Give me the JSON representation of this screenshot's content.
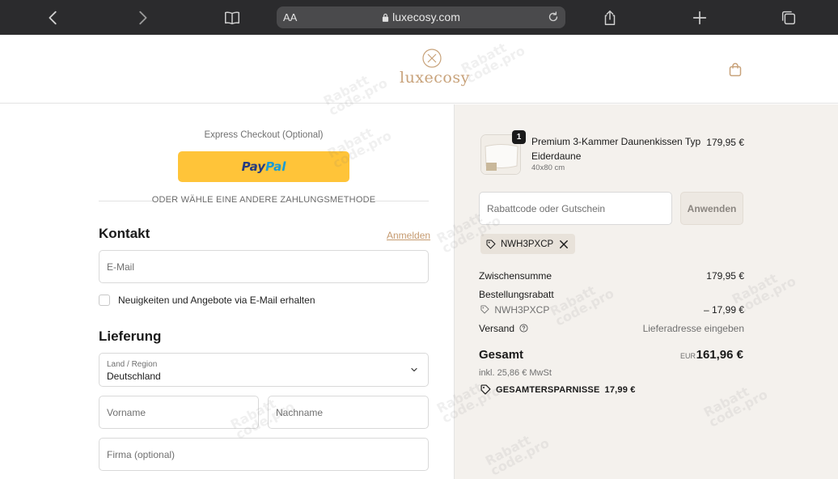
{
  "browser": {
    "text_size_label": "AA",
    "url": "luxecosy.com"
  },
  "header": {
    "brand": "luxecosy"
  },
  "checkout": {
    "express_label": "Express Checkout (Optional)",
    "paypal_label_1": "Pay",
    "paypal_label_2": "Pal",
    "divider_text": "ODER WÄHLE EINE ANDERE ZAHLUNGSMETHODE",
    "contact": {
      "title": "Kontakt",
      "login_link": "Anmelden",
      "email_placeholder": "E-Mail",
      "newsletter_label": "Neuigkeiten und Angebote via E-Mail erhalten"
    },
    "delivery": {
      "title": "Lieferung",
      "country_label": "Land / Region",
      "country_value": "Deutschland",
      "first_name_placeholder": "Vorname",
      "last_name_placeholder": "Nachname",
      "company_placeholder": "Firma (optional)"
    }
  },
  "summary": {
    "item": {
      "quantity": "1",
      "name": "Premium 3-Kammer Daunenkissen Typ Eiderdaune",
      "variant": "40x80 cm",
      "price": "179,95 €"
    },
    "discount_placeholder": "Rabattcode oder Gutschein",
    "apply_label": "Anwenden",
    "applied_code": "NWH3PXCP",
    "subtotal_label": "Zwischensumme",
    "subtotal_value": "179,95 €",
    "order_discount_label": "Bestellungsrabatt",
    "order_discount_code": "NWH3PXCP",
    "order_discount_value": "– 17,99 €",
    "shipping_label": "Versand",
    "shipping_value": "Lieferadresse eingeben",
    "total_label": "Gesamt",
    "currency": "EUR",
    "total_value": "161,96 €",
    "tax_note": "inkl. 25,86 € MwSt",
    "savings_label": "GESAMTERSPARNISSE",
    "savings_value": "17,99 €"
  },
  "watermark": {
    "line1": "Rabatt",
    "line2": "code.pro"
  }
}
